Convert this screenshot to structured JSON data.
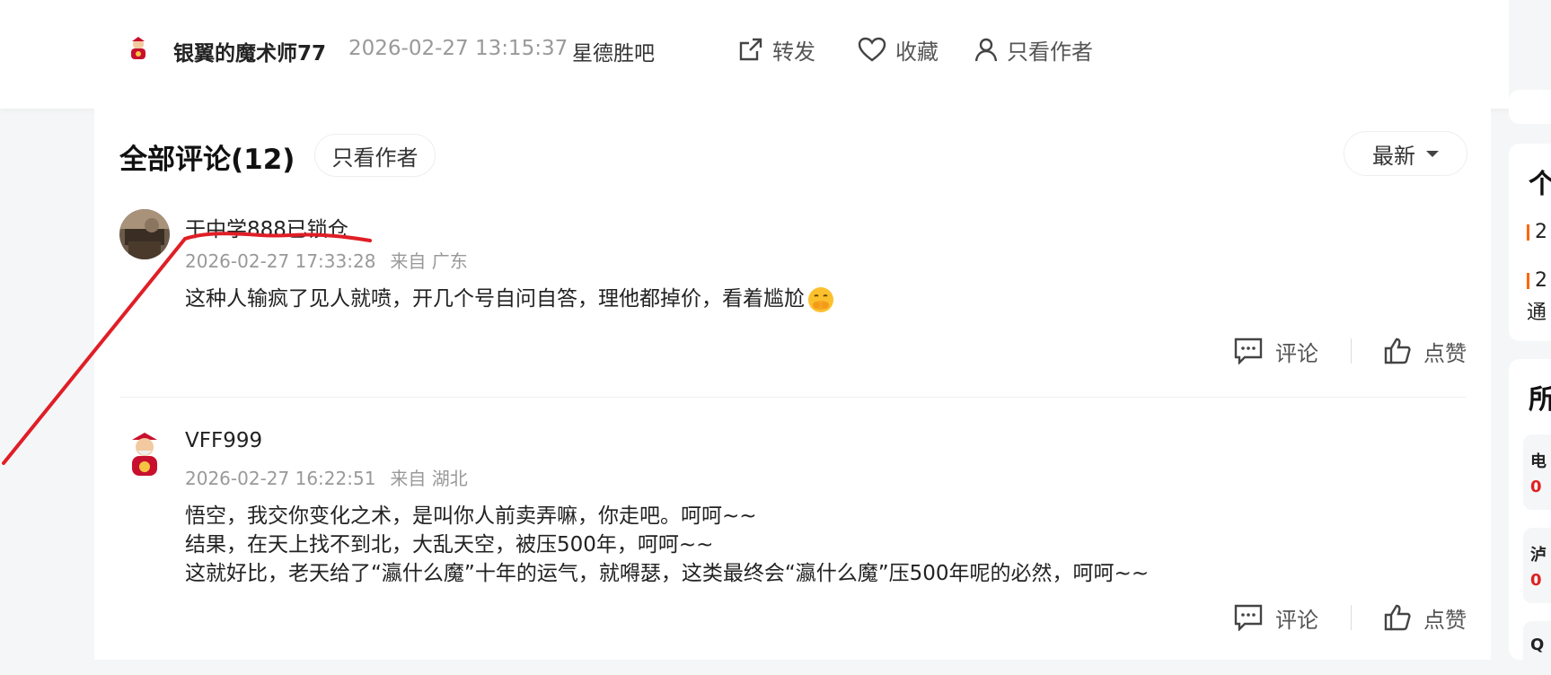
{
  "post_header": {
    "author": "银翼的魔术师77",
    "time": "2026-02-27 13:15:37",
    "forum": "星德胜吧",
    "actions": {
      "share": "转发",
      "favorite": "收藏",
      "only_author": "只看作者"
    }
  },
  "comments_section": {
    "title": "全部评论(12)",
    "only_author_filter": "只看作者",
    "sort": "最新"
  },
  "comments": [
    {
      "name": "干中学888已锁仓",
      "time": "2026-02-27 17:33:28",
      "location": "来自 广东",
      "lines": [
        "这种人输疯了见人就喷，开几个号自问自答，理他都掉价，看着尴尬"
      ],
      "comment_label": "评论",
      "like_label": "点赞"
    },
    {
      "name": "VFF999",
      "time": "2026-02-27 16:22:51",
      "location": "来自 湖北",
      "lines": [
        "悟空，我交你变化之术，是叫你人前卖弄嘛，你走吧。呵呵~~",
        "结果，在天上找不到北，大乱天空，被压500年，呵呵~~",
        "这就好比，老天给了“瀛什么魔”十年的运气，就嘚瑟，这类最终会“瀛什么魔”压500年呢的必然，呵呵~~"
      ],
      "comment_label": "评论",
      "like_label": "点赞"
    }
  ],
  "sidebar_fragments": {
    "card1_title": "个",
    "card1_line1": "2",
    "card1_line2": "2",
    "card1_line3": "通",
    "card2_title": "所",
    "card2_item1_a": "电",
    "card2_item1_b": "0",
    "card2_item2_a": "泸",
    "card2_item2_b": "0",
    "card2_item3_a": "Q"
  },
  "colors": {
    "annotation_red": "#e01e26",
    "accent_orange": "#ff6600",
    "sidebar_red": "#e02020"
  }
}
